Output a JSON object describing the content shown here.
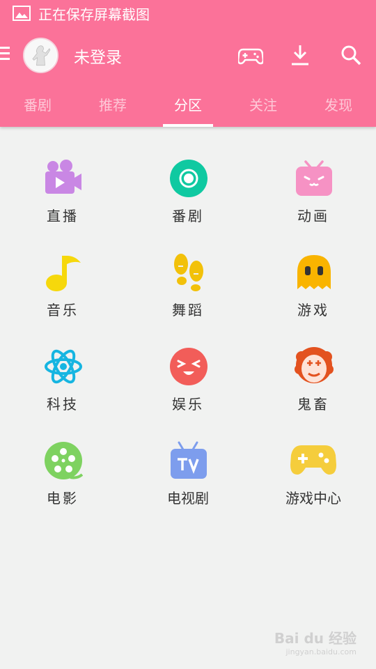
{
  "status_bar": {
    "text": "正在保存屏幕截图",
    "icon": "image-icon"
  },
  "app_bar": {
    "username": "未登录",
    "icons": [
      "menu-icon",
      "game-controller-icon",
      "download-icon",
      "search-icon"
    ]
  },
  "tabs": [
    {
      "label": "番剧"
    },
    {
      "label": "推荐"
    },
    {
      "label": "分区",
      "active": true
    },
    {
      "label": "关注"
    },
    {
      "label": "发现"
    }
  ],
  "categories": [
    {
      "label": "直播",
      "icon": "video-camera-icon"
    },
    {
      "label": "番剧",
      "icon": "record-circle-icon"
    },
    {
      "label": "动画",
      "icon": "tv-face-icon"
    },
    {
      "label": "音乐",
      "icon": "music-note-icon"
    },
    {
      "label": "舞蹈",
      "icon": "footprints-icon"
    },
    {
      "label": "游戏",
      "icon": "ghost-icon"
    },
    {
      "label": "科技",
      "icon": "atom-icon"
    },
    {
      "label": "娱乐",
      "icon": "laughing-face-icon"
    },
    {
      "label": "鬼畜",
      "icon": "clown-icon"
    },
    {
      "label": "电影",
      "icon": "film-reel-icon"
    },
    {
      "label": "电视剧",
      "icon": "tv-icon"
    },
    {
      "label": "游戏中心",
      "icon": "gamepad-icon"
    }
  ],
  "colors": {
    "header": "#fb7299",
    "background": "#f1f2f1"
  },
  "watermark": {
    "text": "Bai du 经验",
    "sub": "jingyan.baidu.com"
  }
}
